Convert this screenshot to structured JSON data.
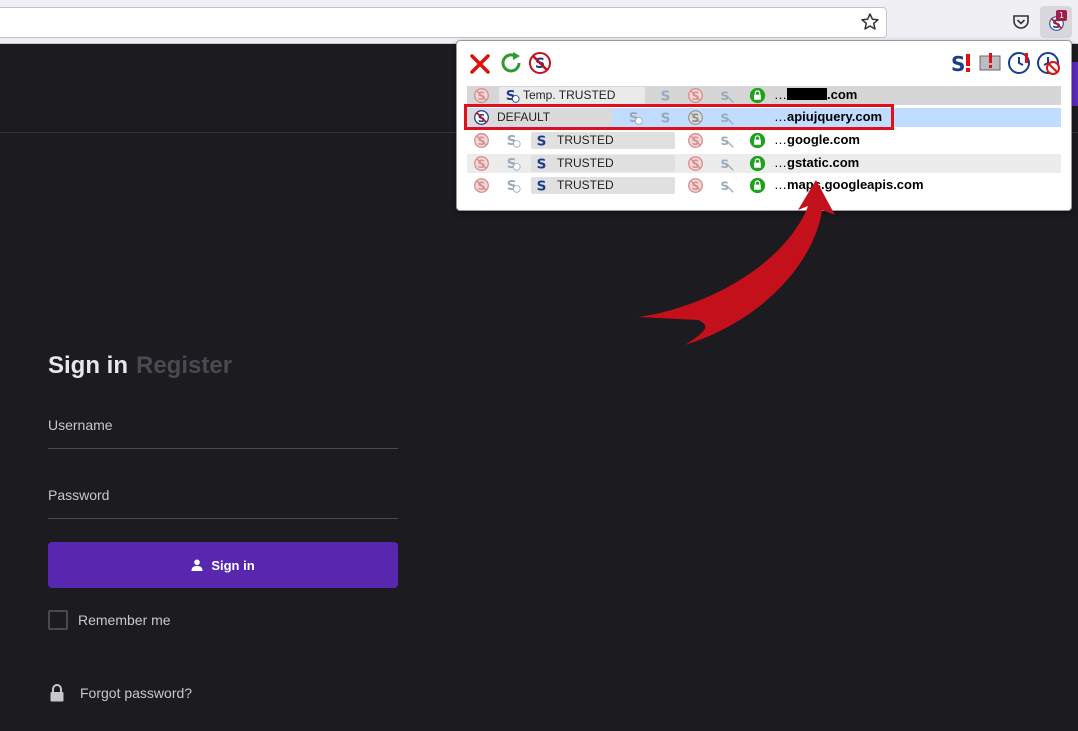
{
  "toolbar": {
    "bookmark_icon": "star-icon",
    "pocket_icon": "pocket-icon",
    "extension_badge": "1"
  },
  "login": {
    "tab_signin": "Sign in",
    "tab_register": "Register",
    "username_label": "Username",
    "password_label": "Password",
    "signin_button": "Sign in",
    "remember_label": "Remember me",
    "forgot_label": "Forgot password?"
  },
  "popup": {
    "rows": [
      {
        "level": "Temp. TRUSTED",
        "prefix": "…",
        "domain": ".com",
        "redacted": true
      },
      {
        "level": "DEFAULT",
        "prefix": "…",
        "domain": "apiujquery.com",
        "redacted": false
      },
      {
        "level": "TRUSTED",
        "prefix": "…",
        "domain": "google.com",
        "redacted": false
      },
      {
        "level": "TRUSTED",
        "prefix": "…",
        "domain": "gstatic.com",
        "redacted": false
      },
      {
        "level": "TRUSTED",
        "prefix": "…",
        "domain": "maps.googleapis.com",
        "redacted": false
      }
    ]
  },
  "colors": {
    "accent_purple": "#5727b0",
    "page_background": "#1c1b1f",
    "highlight_red": "#e0101a",
    "selected_row": "#c0dcff"
  }
}
